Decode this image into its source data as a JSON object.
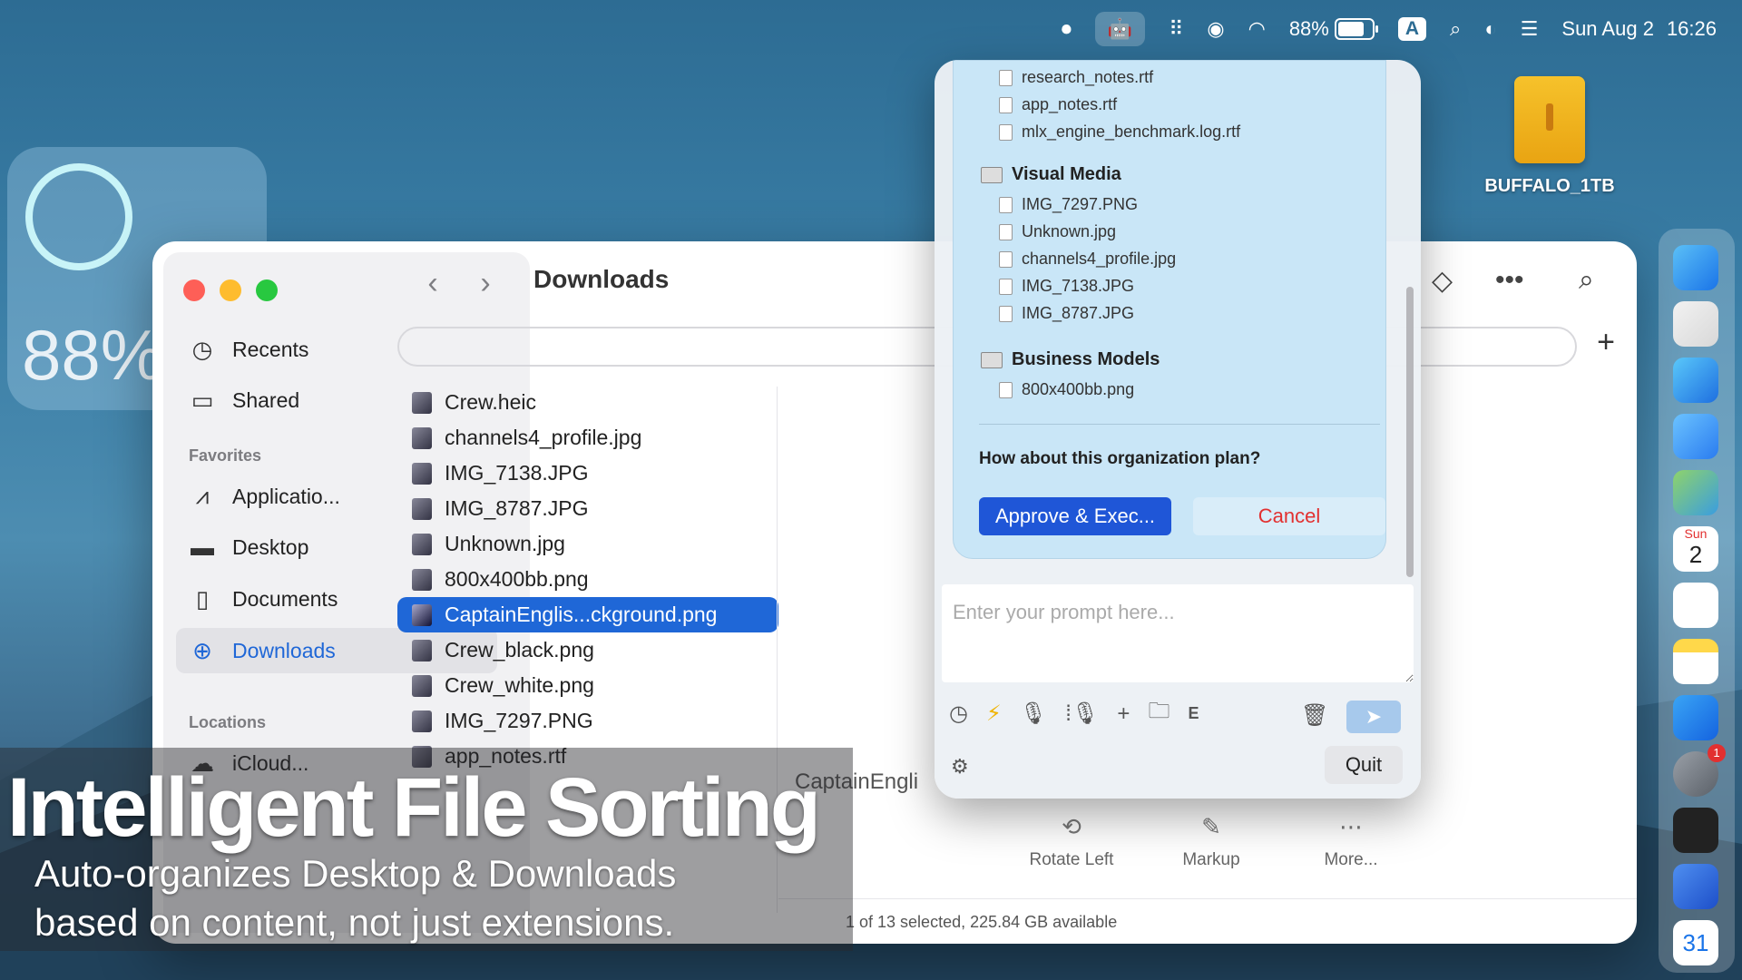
{
  "menubar": {
    "battery_pct": "88%",
    "battery_level": 0.88,
    "input_badge": "A",
    "date": "Sun Aug 2",
    "time": "16:26",
    "icons": [
      "stop-icon",
      "bot-icon",
      "grid-icon",
      "user-icon",
      "wifi-icon",
      "battery-icon",
      "search-icon",
      "siri-icon",
      "control-center-icon"
    ]
  },
  "widget": {
    "battery_text": "88%"
  },
  "desktop_drive": {
    "label": "BUFFALO_1TB"
  },
  "finder": {
    "title": "Downloads",
    "sidebar": {
      "recents": "Recents",
      "shared": "Shared",
      "favorites_header": "Favorites",
      "applications": "Applicatio...",
      "desktop": "Desktop",
      "documents": "Documents",
      "downloads": "Downloads",
      "locations_header": "Locations",
      "icloud": "iCloud..."
    },
    "files": [
      "Crew.heic",
      "channels4_profile.jpg",
      "IMG_7138.JPG",
      "IMG_8787.JPG",
      "Unknown.jpg",
      "800x400bb.png",
      "CaptainEnglis...ckground.png",
      "Crew_black.png",
      "Crew_white.png",
      "IMG_7297.PNG",
      "app_notes.rtf"
    ],
    "selected_index": 6,
    "preview_name": "CaptainEngli",
    "actions": {
      "rotate": "Rotate Left",
      "markup": "Markup",
      "more": "More..."
    },
    "status": "1 of 13 selected, 225.84 GB available"
  },
  "plan": {
    "top_items": [
      "research_notes.rtf",
      "app_notes.rtf",
      "mlx_engine_benchmark.log.rtf"
    ],
    "folder_visual": "Visual Media",
    "visual_items": [
      "IMG_7297.PNG",
      "Unknown.jpg",
      "channels4_profile.jpg",
      "IMG_7138.JPG",
      "IMG_8787.JPG"
    ],
    "folder_business": "Business Models",
    "business_items": [
      "800x400bb.png"
    ],
    "question": "How about this organization plan?",
    "approve": "Approve & Exec...",
    "cancel": "Cancel",
    "prompt_placeholder": "Enter your prompt here...",
    "quit": "Quit",
    "tool_e": "E"
  },
  "dock": {
    "calendar_day": "31",
    "date_num": "2",
    "date_label": "Sun",
    "badge": "1"
  },
  "caption": {
    "title": "Intelligent File Sorting",
    "line1": "Auto-organizes Desktop & Downloads",
    "line2": "based on content, not just extensions."
  }
}
